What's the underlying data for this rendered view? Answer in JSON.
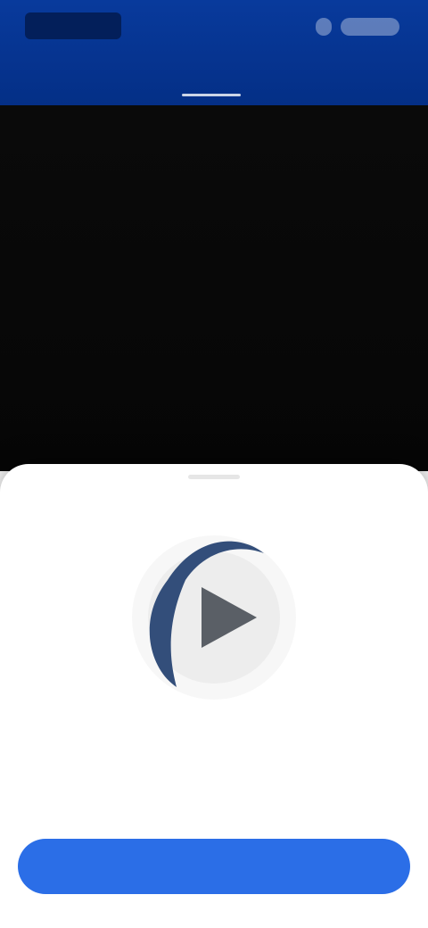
{
  "header": {
    "logo_text": "",
    "tabs": [
      {
        "label": "",
        "active": true
      },
      {
        "label": "",
        "active": false
      }
    ]
  },
  "sheet": {
    "title": "",
    "description": "",
    "primary_button_label": ""
  },
  "colors": {
    "header": "#083a9c",
    "video_background": "#0a0a0a",
    "primary_button": "#2b6ee7",
    "hero_arc": "#334e7a",
    "play_icon": "#5a5f66"
  },
  "icons": {
    "hero": "play-icon"
  }
}
